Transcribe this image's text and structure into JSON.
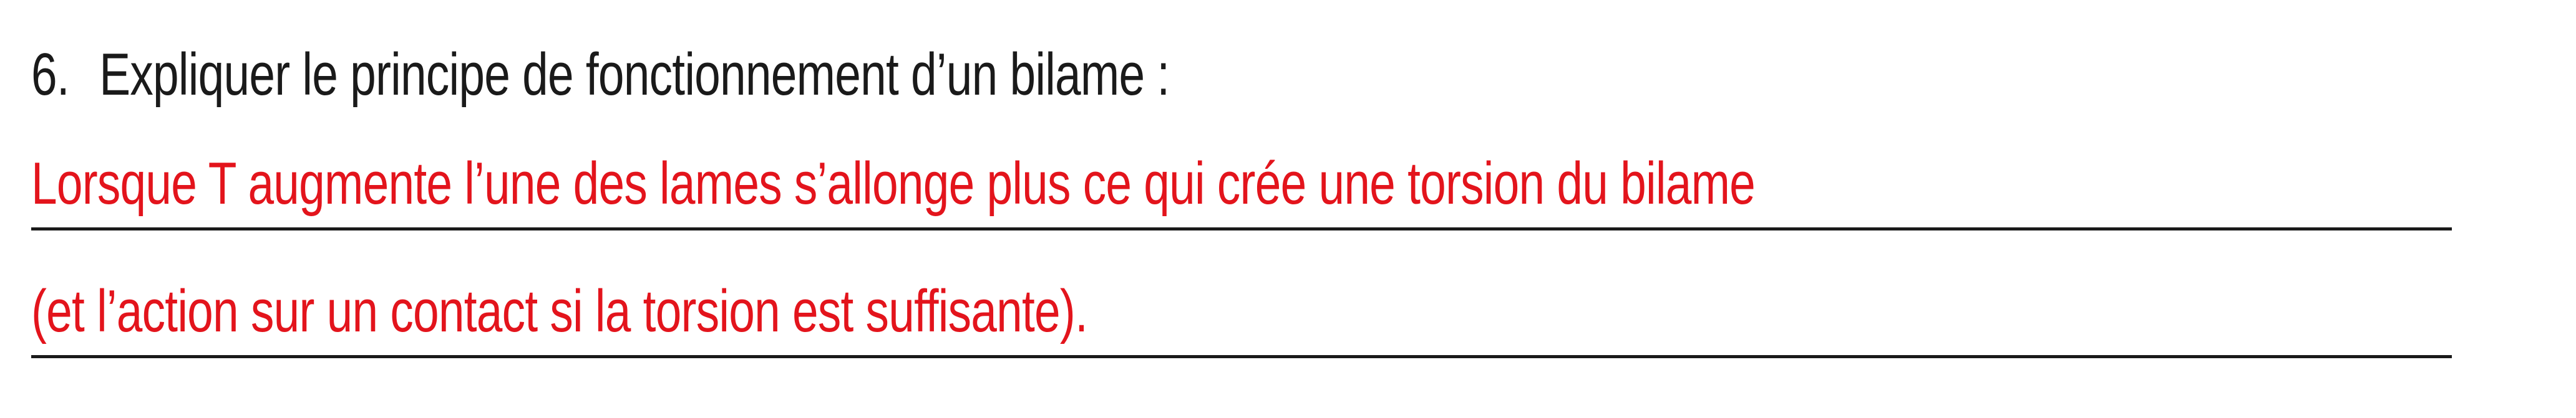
{
  "question": {
    "number": "6.",
    "text": "Expliquer le principe de fonctionnement d’un bilame :"
  },
  "answer": {
    "lines": [
      "Lorsque T augmente l’une des lames s’allonge plus ce qui crée une torsion du bilame",
      "(et l’action sur un contact si la torsion est suffisante)."
    ],
    "color": "#e3141c"
  }
}
